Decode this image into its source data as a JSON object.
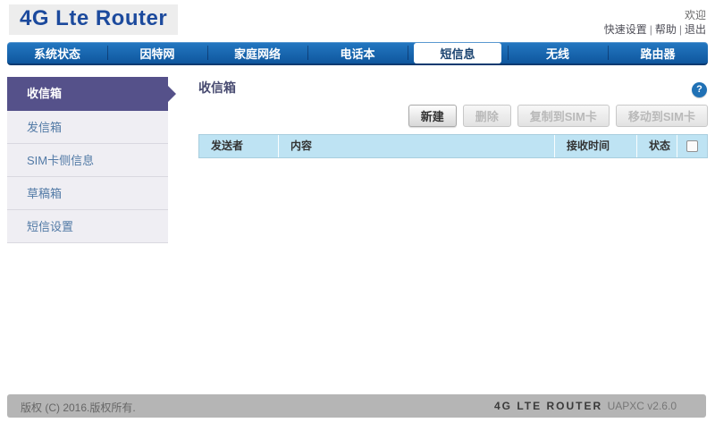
{
  "header": {
    "logo": "4G Lte Router",
    "welcome": "欢迎",
    "links": [
      {
        "label": "快速设置"
      },
      {
        "label": "帮助"
      },
      {
        "label": "退出"
      }
    ],
    "link_separator": "|"
  },
  "nav": {
    "tabs": [
      {
        "label": "系统状态",
        "active": false
      },
      {
        "label": "因特网",
        "active": false
      },
      {
        "label": "家庭网络",
        "active": false
      },
      {
        "label": "电话本",
        "active": false
      },
      {
        "label": "短信息",
        "active": true
      },
      {
        "label": "无线",
        "active": false
      },
      {
        "label": "路由器",
        "active": false
      }
    ]
  },
  "sidebar": {
    "items": [
      {
        "label": "收信箱",
        "active": true
      },
      {
        "label": "发信箱",
        "active": false
      },
      {
        "label": "SIM卡侧信息",
        "active": false
      },
      {
        "label": "草稿箱",
        "active": false
      },
      {
        "label": "短信设置",
        "active": false
      }
    ]
  },
  "main": {
    "title": "收信箱",
    "help_icon": "?",
    "buttons": [
      {
        "label": "新建",
        "enabled": true
      },
      {
        "label": "删除",
        "enabled": false
      },
      {
        "label": "复制到SIM卡",
        "enabled": false
      },
      {
        "label": "移动到SIM卡",
        "enabled": false
      }
    ],
    "table": {
      "columns": [
        "发送者",
        "内容",
        "接收时间",
        "状态"
      ],
      "rows": []
    }
  },
  "footer": {
    "copyright": "版权 (C) 2016.版权所有.",
    "brand": "4G LTE ROUTER",
    "version": "UAPXC v2.6.0"
  },
  "colors": {
    "nav_blue_top": "#2478c2",
    "nav_blue_bottom": "#0f579e",
    "sidebar_active_purple": "#55518a",
    "sidebar_bg": "#efeef3",
    "table_header_blue": "#bee3f3",
    "footer_gray": "#b5b5b5",
    "logo_blue": "#1c4a9d",
    "help_blue": "#2071b5"
  }
}
